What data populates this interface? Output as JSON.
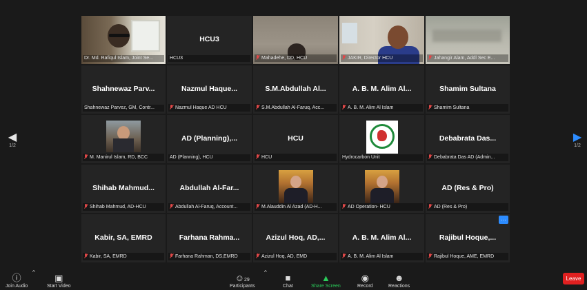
{
  "tiles": [
    {
      "type": "video",
      "scene": "v1",
      "label": "Dr. Md. Rafiqul Islam, Joint Se...",
      "muted": false,
      "active": true
    },
    {
      "type": "name",
      "name": "HCU3",
      "label": "HCU3",
      "muted": false
    },
    {
      "type": "video",
      "scene": "v3",
      "label": "Mahadehe, DD, HCU",
      "muted": true
    },
    {
      "type": "video",
      "scene": "v4",
      "label": "JAKIR, Director HCU",
      "muted": true
    },
    {
      "type": "video",
      "scene": "v5",
      "label": "Jahangir Alam, Addl Sec E...",
      "muted": true
    },
    {
      "type": "name",
      "name": "Shahnewaz Parv...",
      "label": "Shahnewaz Parvez, GM, Contr...",
      "muted": false
    },
    {
      "type": "name",
      "name": "Nazmul Haque...",
      "label": "Nazmul Haque AD HCU",
      "muted": true
    },
    {
      "type": "name",
      "name": "S.M.Abdullah Al...",
      "label": "S.M.Abdullah Al-Faruq, Acc...",
      "muted": true
    },
    {
      "type": "name",
      "name": "A. B. M. Alim Al...",
      "label": "A. B. M. Alim Al Islam",
      "muted": true
    },
    {
      "type": "name",
      "name": "Shamim Sultana",
      "label": "Shamim Sultana",
      "muted": true
    },
    {
      "type": "photo",
      "photo": "office",
      "label": "M. Manirul Islam, RD, BCC",
      "muted": true
    },
    {
      "type": "name",
      "name": "AD (Planning),...",
      "label": "AD (Planning), HCU",
      "muted": false
    },
    {
      "type": "name",
      "name": "HCU",
      "label": "HCU",
      "muted": true
    },
    {
      "type": "photo",
      "photo": "logo",
      "label": "Hydrocarbon Unit",
      "muted": false
    },
    {
      "type": "name",
      "name": "Debabrata Das...",
      "label": "Debabrata Das AD (Admin...",
      "muted": true
    },
    {
      "type": "name",
      "name": "Shihab Mahmud...",
      "label": "Shihab Mahmud, AD-HCU",
      "muted": true
    },
    {
      "type": "name",
      "name": "Abdullah Al-Far...",
      "label": "Abdullah Al-Faruq, Account...",
      "muted": true
    },
    {
      "type": "photo",
      "photo": "suit",
      "label": "M.Alauddin Al Azad (AD-H...",
      "muted": true
    },
    {
      "type": "photo",
      "photo": "suit",
      "label": "AD Operation- HCU",
      "muted": true
    },
    {
      "type": "name",
      "name": "AD (Res & Pro)",
      "label": "AD (Res & Pro)",
      "muted": true
    },
    {
      "type": "name",
      "name": "Kabir, SA, EMRD",
      "label": "Kabir, SA, EMRD",
      "muted": true
    },
    {
      "type": "name",
      "name": "Farhana Rahma...",
      "label": "Farhana Rahman, DS,EMRD",
      "muted": true
    },
    {
      "type": "name",
      "name": "Azizul Hoq, AD,...",
      "label": "Azizul Hoq, AD, EMD",
      "muted": true
    },
    {
      "type": "name",
      "name": "A. B. M. Alim Al...",
      "label": "A. B. M. Alim Al Islam",
      "muted": true
    },
    {
      "type": "name",
      "name": "Rajibul Hoque,...",
      "label": "Rajibul Hoque, AME, EMRD",
      "muted": true,
      "badge": true
    }
  ],
  "pager": {
    "left": "1/2",
    "right": "1/2"
  },
  "toolbar": {
    "join_audio": "Join Audio",
    "start_video": "Start Video",
    "participants": "Participants",
    "participants_count": "29",
    "chat": "Chat",
    "share_screen": "Share Screen",
    "record": "Record",
    "reactions": "Reactions",
    "leave": "Leave"
  },
  "colors": {
    "accent": "#2d8cff",
    "share": "#2bcb5a",
    "leave": "#e02020",
    "active_border": "#c9d64a",
    "muted": "#e04848"
  }
}
